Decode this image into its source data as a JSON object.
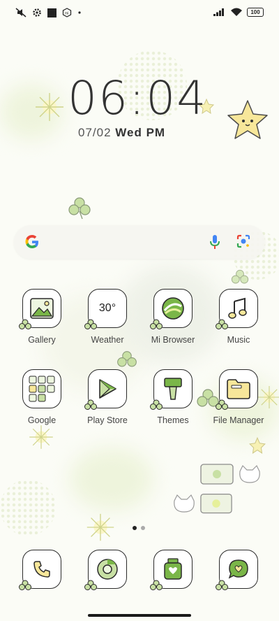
{
  "status_bar": {
    "left_icons": [
      "mute-icon",
      "settings-gear-icon",
      "app-square-icon",
      "mi-icon",
      "dot-icon"
    ],
    "battery_level": "100"
  },
  "lockscreen": {
    "time": "06:04",
    "date": "07/02",
    "weekday": "Wed",
    "period": "PM"
  },
  "search_widget": {
    "logo": "google-logo-icon",
    "voice": "microphone-icon",
    "lens": "google-lens-icon"
  },
  "apps_row1": [
    {
      "label": "Gallery"
    },
    {
      "label": "Weather",
      "temp": "30°"
    },
    {
      "label": "Mi Browser"
    },
    {
      "label": "Music"
    }
  ],
  "apps_row2": [
    {
      "label": "Google"
    },
    {
      "label": "Play Store"
    },
    {
      "label": "Themes"
    },
    {
      "label": "File Manager"
    }
  ],
  "dock": [
    "phone-icon",
    "chrome-icon",
    "camera-icon",
    "messages-icon"
  ],
  "pager": {
    "pages": 2,
    "current": 1
  },
  "colors": {
    "accent_green": "#7ab648",
    "leaf_light": "#c8e0a4",
    "icon_yellow": "#f7e79a",
    "outline": "#2b2b2b"
  }
}
